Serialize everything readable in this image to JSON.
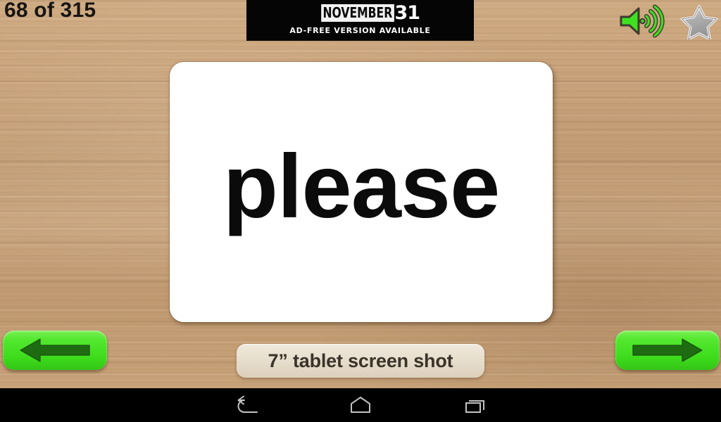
{
  "app": {
    "background": "wood-texture",
    "background_color": "#c5a077"
  },
  "header": {
    "counter": "68 of 315",
    "counter_current": 68,
    "counter_total": 315,
    "counter_color": "#171512",
    "sound_button": {
      "icon": "speaker-sound-icon",
      "color": "#3ee01f",
      "label": "Play sound"
    },
    "favorite_button": {
      "icon": "star-icon",
      "state": "inactive",
      "color": "#b9b9b9",
      "label": "Favorite"
    }
  },
  "ad": {
    "logo_word": "NOVEMBER",
    "logo_number": "31",
    "subtitle": "AD-FREE VERSION AVAILABLE",
    "background_color": "#050505",
    "text_color": "#ffffff"
  },
  "card": {
    "word": "please",
    "background_color": "#ffffff",
    "text_color": "#0b0b0b"
  },
  "controls": {
    "previous": {
      "label": "Previous card",
      "icon": "arrow-left-icon",
      "color": "#3ddb1b"
    },
    "next": {
      "label": "Next card",
      "icon": "arrow-right-icon",
      "color": "#3ddb1b"
    }
  },
  "caption": {
    "text": "7” tablet screen shot",
    "background_color": "#e6dccb",
    "text_color": "#3b332a"
  },
  "system_navbar": {
    "background_color": "#000000",
    "buttons": [
      {
        "name": "back",
        "icon": "back-arrow-icon",
        "label": "Back"
      },
      {
        "name": "home",
        "icon": "home-icon",
        "label": "Home"
      },
      {
        "name": "recents",
        "icon": "recents-icon",
        "label": "Recent apps"
      }
    ]
  }
}
